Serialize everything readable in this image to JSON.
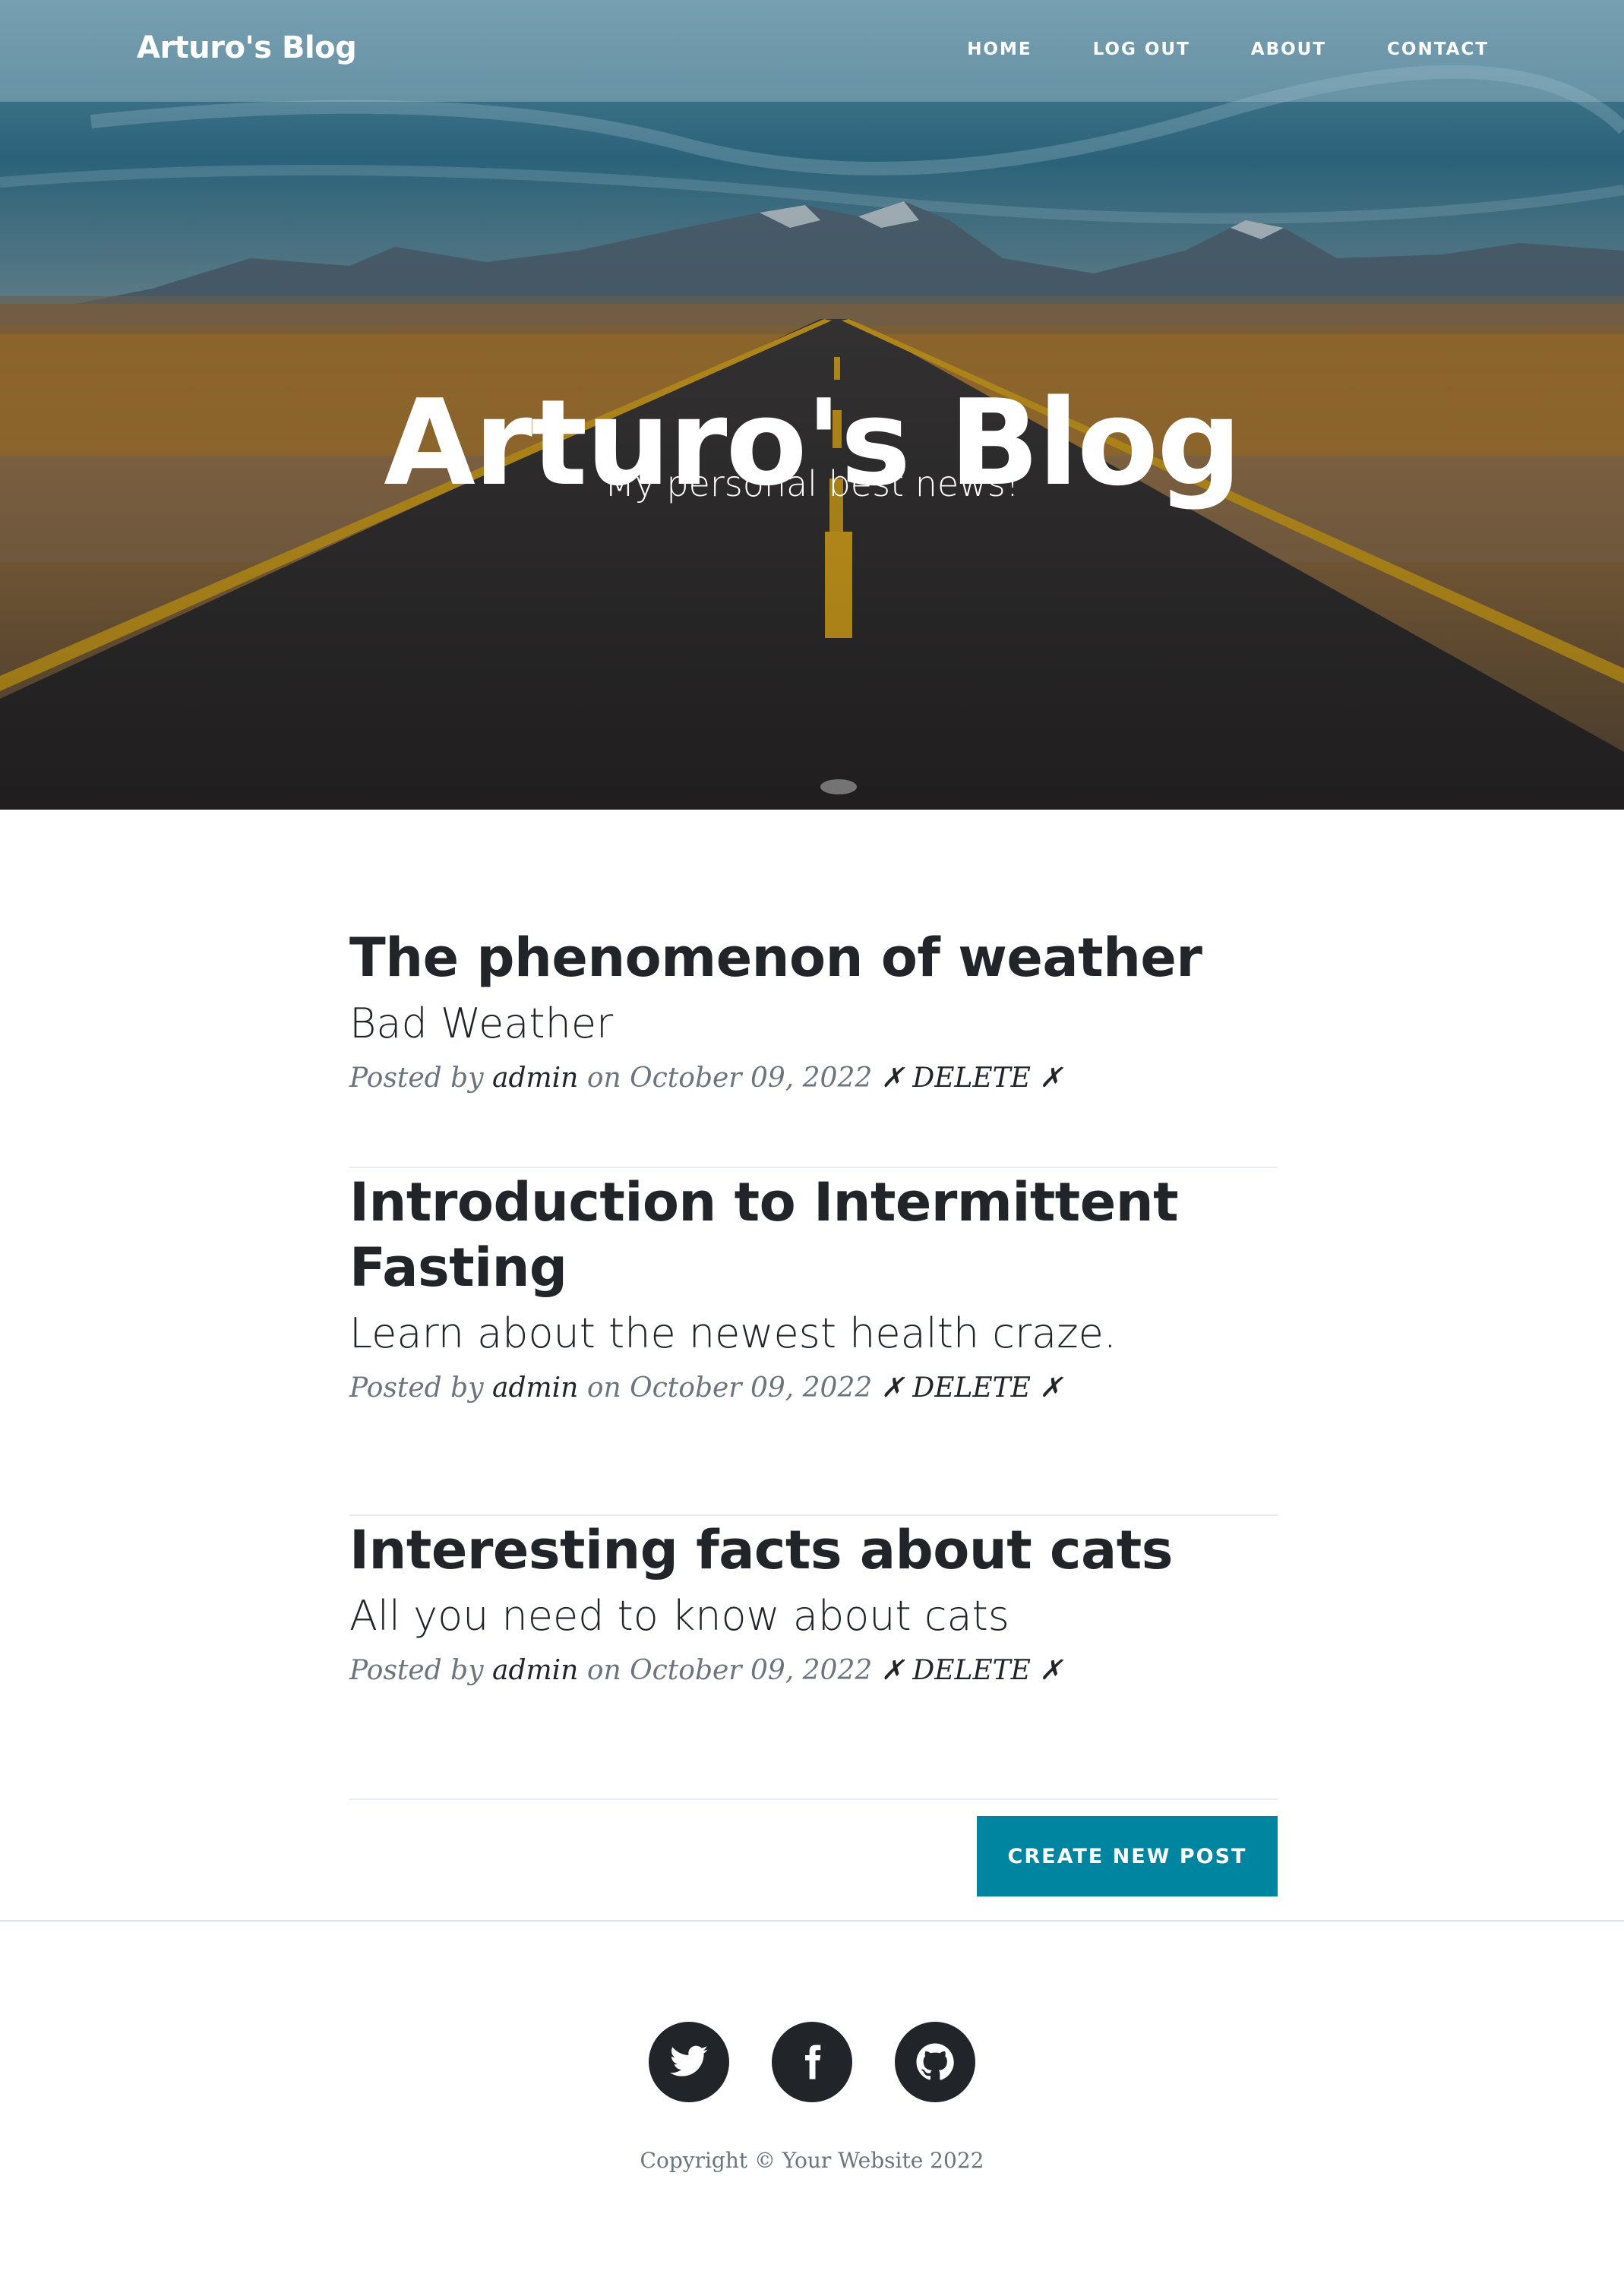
{
  "navbar": {
    "brand": "Arturo's Blog",
    "links": [
      "HOME",
      "LOG OUT",
      "ABOUT",
      "CONTACT"
    ]
  },
  "hero": {
    "title": "Arturo's Blog",
    "subtitle": "My personal best news!"
  },
  "posts": [
    {
      "title": "The phenomenon of weather",
      "subtitle": "Bad Weather",
      "posted_by": "Posted by",
      "author": "admin",
      "on": "on",
      "date": "October 09, 2022",
      "delete": "✗ DELETE ✗"
    },
    {
      "title": "Introduction to Intermittent Fasting",
      "subtitle": "Learn about the newest health craze.",
      "posted_by": "Posted by",
      "author": "admin",
      "on": "on",
      "date": "October 09, 2022",
      "delete": "✗ DELETE ✗"
    },
    {
      "title": "Interesting facts about cats",
      "subtitle": "All you need to know about cats",
      "posted_by": "Posted by",
      "author": "admin",
      "on": "on",
      "date": "October 09, 2022",
      "delete": "✗ DELETE ✗"
    }
  ],
  "create_button": "CREATE NEW POST",
  "footer": {
    "social": [
      "twitter-icon",
      "facebook-icon",
      "github-icon"
    ],
    "copyright": "Copyright © Your Website 2022"
  },
  "colors": {
    "accent": "#0085a1",
    "text": "#212529",
    "muted": "#6c757d"
  }
}
